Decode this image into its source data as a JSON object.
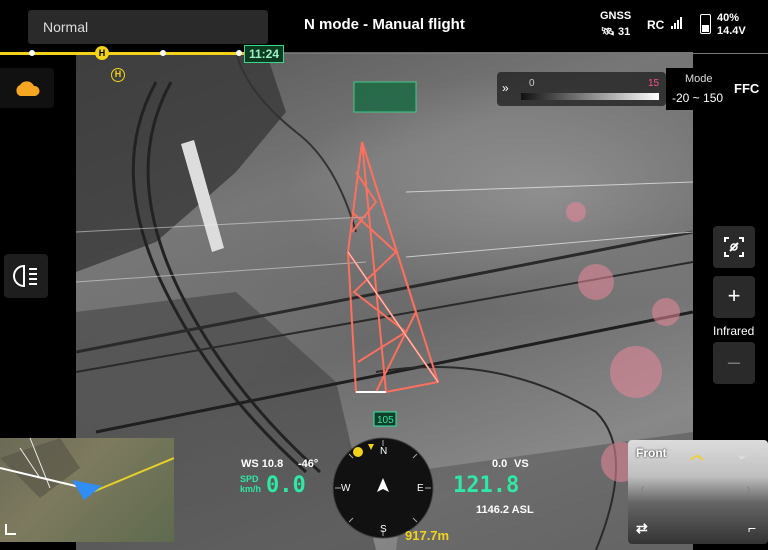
{
  "header": {
    "mode_select": "Normal",
    "flight_mode": "N mode - Manual flight",
    "gnss_label": "GNSS",
    "gnss_sats": "31",
    "rc_label": "RC",
    "battery_pct": "40%",
    "battery_voltage": "14.4V"
  },
  "route": {
    "time_remaining": "11:24",
    "home_label": "H"
  },
  "thermal": {
    "palette_low": "0",
    "palette_high": "15",
    "mode_label": "Mode",
    "range": "-20 ~ 150",
    "ffc_label": "FFC"
  },
  "right_controls": {
    "infrared_label": "Infrared",
    "zoom_in": "+",
    "zoom_out": "–"
  },
  "hud": {
    "wind_speed": "WS 10.8",
    "wind_dir": "-46°",
    "speed_unit_top": "SPD",
    "speed_unit_bottom": "km/h",
    "speed_value": "0.0",
    "vs_value": "0.0",
    "vs_label": "VS",
    "alt_value": "121.8",
    "asl_value": "1146.2 ASL",
    "heading_tick": "105",
    "distance": "917.7m",
    "compass": {
      "n": "N",
      "e": "E",
      "s": "S",
      "w": "W"
    }
  },
  "front_view": {
    "title": "Front"
  },
  "colors": {
    "accent_yellow": "#f3d21b",
    "accent_green": "#2ee8a4",
    "tower": "#ff6f5e"
  },
  "icons": [
    "cloud-icon",
    "headlight-icon",
    "crosshair-icon",
    "satellite-icon",
    "battery-icon",
    "signal-icon",
    "swap-icon"
  ]
}
